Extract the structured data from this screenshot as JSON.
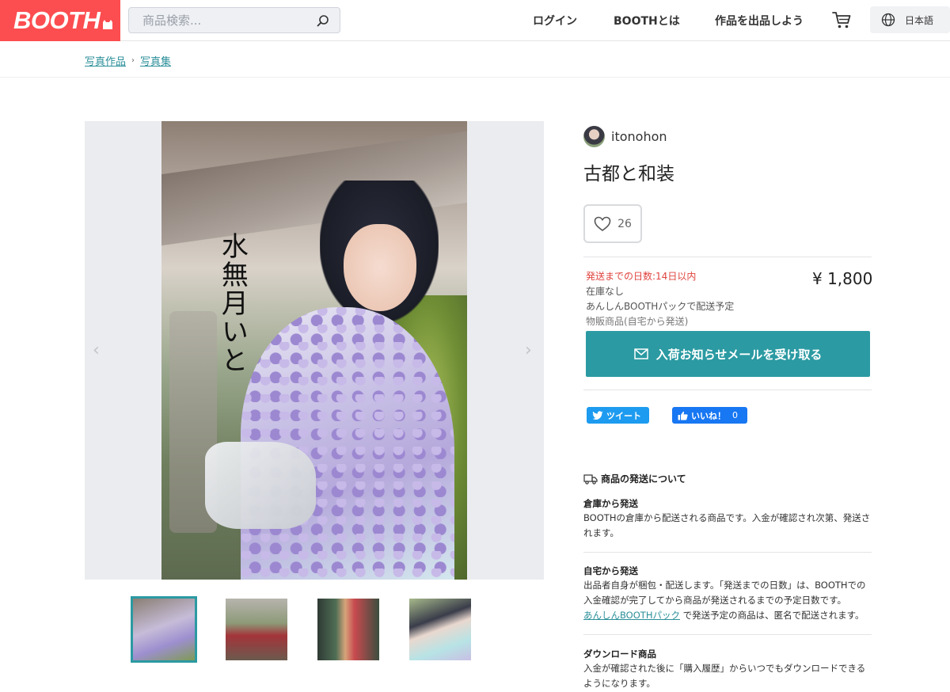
{
  "header": {
    "logo": "BOOTH",
    "search_placeholder": "商品検索...",
    "nav": [
      "ログイン",
      "BOOTHとは",
      "作品を出品しよう"
    ],
    "language": "日本語"
  },
  "breadcrumb": [
    "写真作品",
    "写真集"
  ],
  "gallery": {
    "cover_text": "水無月いと",
    "prev_arrow": "‹",
    "next_arrow": "›"
  },
  "product": {
    "seller": "itonohon",
    "title": "古都と和装",
    "likes": "26",
    "ship_days": "発送までの日数:14日以内",
    "price": "¥ 1,800",
    "stock": "在庫なし",
    "anshin": "あんしんBOOTHパックで配送予定",
    "ship_type": "物販商品(自宅から発送)",
    "notify_button": "入荷お知らせメールを受け取る"
  },
  "social": {
    "tweet": "ツイート",
    "fb_like": "いいね！",
    "fb_count": "0"
  },
  "shipping_info": {
    "heading": "商品の発送について",
    "warehouse_title": "倉庫から発送",
    "warehouse_text": "BOOTHの倉庫から配送される商品です。入金が確認され次第、発送されます。",
    "self_title": "自宅から発送",
    "self_text": "出品者自身が梱包・配送します。「発送までの日数」は、BOOTHでの入金確認が完了してから商品が発送されるまでの予定日数です。",
    "self_link": "あんしんBOOTHパック",
    "self_text2": " で発送予定の商品は、匿名で配送されます。",
    "download_title": "ダウンロード商品",
    "download_text": "入金が確認された後に「購入履歴」からいつでもダウンロードできるようになります。"
  },
  "colors": {
    "brand": "#fc4d50",
    "accent": "#2b9aa2",
    "warning": "#e0443f",
    "twitter": "#1d9bf0",
    "facebook": "#1877f2"
  },
  "icons": [
    "search-icon",
    "cart-icon",
    "globe-icon",
    "heart-icon",
    "mail-icon",
    "twitter-icon",
    "thumbs-up-icon",
    "truck-icon"
  ]
}
